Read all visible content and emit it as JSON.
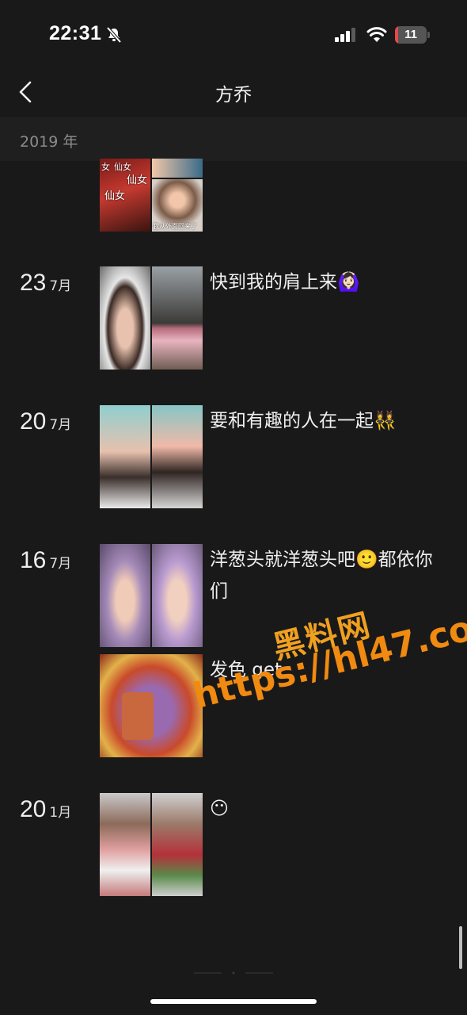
{
  "status_bar": {
    "time": "22:31",
    "battery": "11",
    "battery_level": 0.11
  },
  "header": {
    "title": "方乔",
    "back_icon": "chevron-left-icon"
  },
  "year_header": "2019 年",
  "partial_post": {
    "overlay_texts": [
      "女",
      "仙女",
      "仙女",
      "我从外面回来了"
    ]
  },
  "entries": [
    {
      "day": "23",
      "month": "7月",
      "captions": [
        "快到我的肩上来🙆🏻‍♀️"
      ]
    },
    {
      "day": "20",
      "month": "7月",
      "captions": [
        "要和有趣的人在一起👯‍♀️"
      ]
    },
    {
      "day": "16",
      "month": "7月",
      "captions": [
        "洋葱头就洋葱头吧🙂都依你们",
        "发色 get"
      ]
    },
    {
      "day": "20",
      "month": "1月",
      "captions": [
        "😶"
      ]
    }
  ],
  "watermark": {
    "line1": "黑料网",
    "line2": "https://hl47.co"
  },
  "colors": {
    "background": "#191919",
    "text": "#ededed",
    "watermark": "#f0a020"
  }
}
